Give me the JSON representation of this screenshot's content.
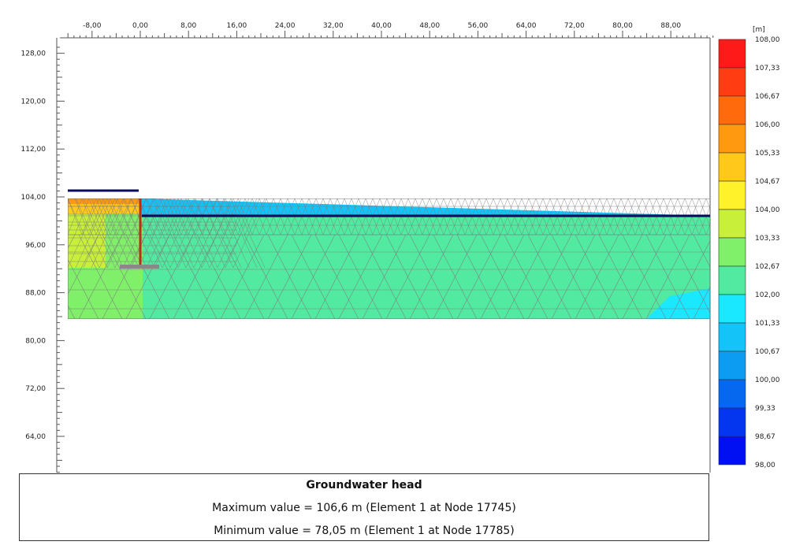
{
  "x_axis": {
    "ticks": [
      "-8,00",
      "0,00",
      "8,00",
      "16,00",
      "24,00",
      "32,00",
      "40,00",
      "48,00",
      "56,00",
      "64,00",
      "72,00",
      "80,00",
      "88,00"
    ],
    "range": [
      -12,
      95.5
    ],
    "major_step": 8,
    "minor_step": 1
  },
  "y_axis": {
    "ticks": [
      "128,00",
      "120,00",
      "112,00",
      "104,00",
      "96,00",
      "88,00",
      "80,00",
      "72,00",
      "64,00"
    ],
    "range": [
      57,
      129
    ],
    "major_step": 8,
    "minor_step": 1
  },
  "legend": {
    "unit": "[m]",
    "levels": [
      "108,00",
      "107,33",
      "106,67",
      "106,00",
      "105,33",
      "104,67",
      "104,00",
      "103,33",
      "102,67",
      "102,00",
      "101,33",
      "100,67",
      "100,00",
      "99,33",
      "98,67",
      "98,00"
    ],
    "colors": [
      "#ff1a1a",
      "#ff3c12",
      "#ff6a0c",
      "#ff9a10",
      "#ffc81a",
      "#fff22a",
      "#c8f03a",
      "#80f06a",
      "#52eaa0",
      "#1ae8ff",
      "#14c4f8",
      "#0c9cf2",
      "#0668ee",
      "#0436f0",
      "#0010f2"
    ]
  },
  "colors": {
    "soil_main": "#52eaa0",
    "soil_left": "#80f06a",
    "soil_left_high": "#c8f03a",
    "wedge_top": "#14c4f8",
    "corner": "#1ae8ff",
    "retained_warm": "#ffc81a",
    "retained_hot": "#ff9a10",
    "water_line": "#0a0a5a",
    "wall": "#b0301a",
    "anchor": "#888888",
    "mesh": "#7a7a7a"
  },
  "info": {
    "title": "Groundwater head",
    "max_line": "Maximum value = 106,6 m (Element 1 at Node 17745)",
    "min_line": "Minimum value = 78,05 m (Element 1 at Node 17785)"
  }
}
